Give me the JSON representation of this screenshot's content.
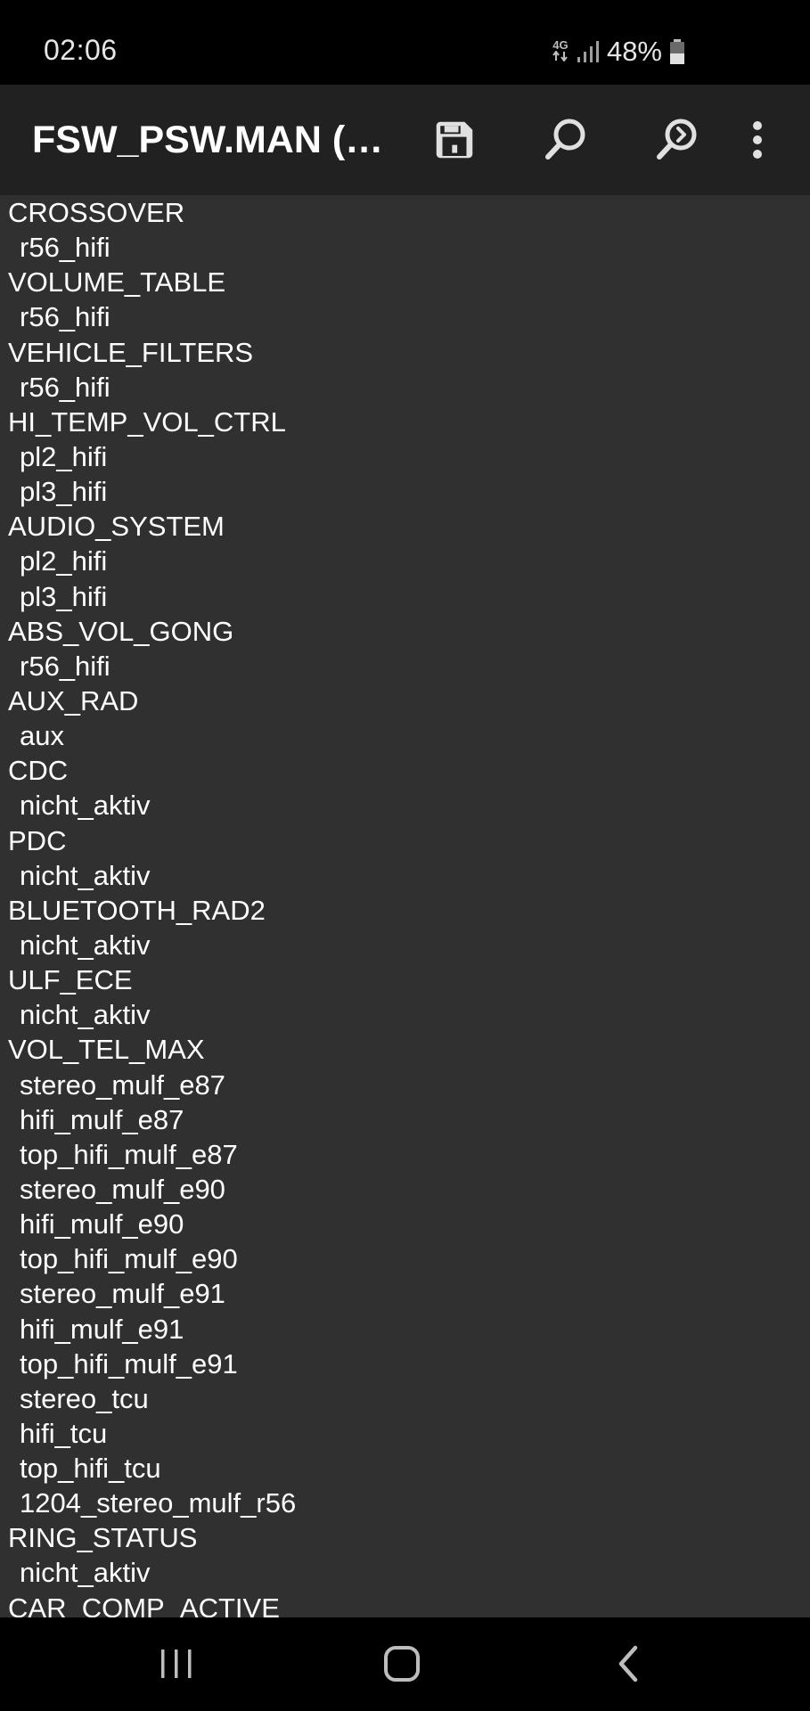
{
  "status_bar": {
    "time": "02:06",
    "network_type": "4G",
    "battery_percent": "48%",
    "battery_level": 0.48
  },
  "toolbar": {
    "title": "FSW_PSW.MAN (И...",
    "icons": [
      "save-icon",
      "search-icon",
      "find-next-icon",
      "more-vert-icon"
    ]
  },
  "lines": [
    {
      "text": "CROSSOVER",
      "level": 0
    },
    {
      "text": "r56_hifi",
      "level": 1
    },
    {
      "text": "VOLUME_TABLE",
      "level": 0
    },
    {
      "text": "r56_hifi",
      "level": 1
    },
    {
      "text": "VEHICLE_FILTERS",
      "level": 0
    },
    {
      "text": "r56_hifi",
      "level": 1
    },
    {
      "text": "HI_TEMP_VOL_CTRL",
      "level": 0
    },
    {
      "text": "pl2_hifi",
      "level": 1
    },
    {
      "text": "pl3_hifi",
      "level": 1
    },
    {
      "text": "AUDIO_SYSTEM",
      "level": 0
    },
    {
      "text": "pl2_hifi",
      "level": 1
    },
    {
      "text": "pl3_hifi",
      "level": 1
    },
    {
      "text": "ABS_VOL_GONG",
      "level": 0
    },
    {
      "text": "r56_hifi",
      "level": 1
    },
    {
      "text": "AUX_RAD",
      "level": 0
    },
    {
      "text": "aux",
      "level": 1
    },
    {
      "text": "CDC",
      "level": 0
    },
    {
      "text": "nicht_aktiv",
      "level": 1
    },
    {
      "text": "PDC",
      "level": 0
    },
    {
      "text": "nicht_aktiv",
      "level": 1
    },
    {
      "text": "BLUETOOTH_RAD2",
      "level": 0
    },
    {
      "text": "nicht_aktiv",
      "level": 1
    },
    {
      "text": "ULF_ECE",
      "level": 0
    },
    {
      "text": "nicht_aktiv",
      "level": 1
    },
    {
      "text": "VOL_TEL_MAX",
      "level": 0
    },
    {
      "text": "stereo_mulf_e87",
      "level": 1
    },
    {
      "text": "hifi_mulf_e87",
      "level": 1
    },
    {
      "text": "top_hifi_mulf_e87",
      "level": 1
    },
    {
      "text": "stereo_mulf_e90",
      "level": 1
    },
    {
      "text": "hifi_mulf_e90",
      "level": 1
    },
    {
      "text": "top_hifi_mulf_e90",
      "level": 1
    },
    {
      "text": "stereo_mulf_e91",
      "level": 1
    },
    {
      "text": "hifi_mulf_e91",
      "level": 1
    },
    {
      "text": "top_hifi_mulf_e91",
      "level": 1
    },
    {
      "text": "stereo_tcu",
      "level": 1
    },
    {
      "text": "hifi_tcu",
      "level": 1
    },
    {
      "text": "top_hifi_tcu",
      "level": 1
    },
    {
      "text": "1204_stereo_mulf_r56",
      "level": 1
    },
    {
      "text": "RING_STATUS",
      "level": 0
    },
    {
      "text": "nicht_aktiv",
      "level": 1
    },
    {
      "text": "CAR_COMP_ACTIVE",
      "level": 0
    }
  ],
  "nav_bar": {
    "icons": [
      "recent-apps-icon",
      "home-icon",
      "back-icon"
    ]
  },
  "colors": {
    "status_bar_bg": "#000000",
    "toolbar_bg": "#212121",
    "content_bg": "#303030",
    "text": "#ffffff",
    "icon": "#e0e0e0"
  }
}
